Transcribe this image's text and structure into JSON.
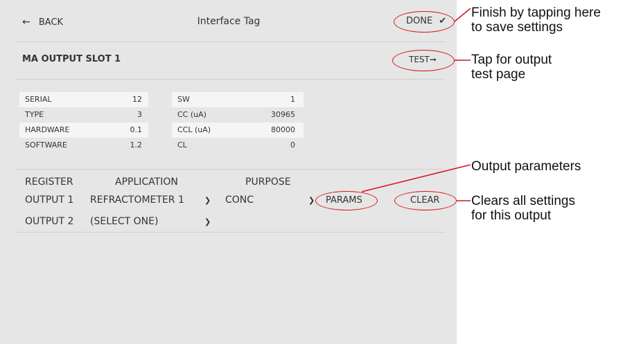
{
  "header": {
    "back_label": "BACK",
    "title": "Interface Tag",
    "done_label": "DONE"
  },
  "slot": {
    "title": "MA OUTPUT SLOT 1",
    "test_label": "TEST"
  },
  "info_left": [
    {
      "label": "SERIAL",
      "value": "12"
    },
    {
      "label": "TYPE",
      "value": "3"
    },
    {
      "label": "HARDWARE",
      "value": "0.1"
    },
    {
      "label": "SOFTWARE",
      "value": "1.2"
    }
  ],
  "info_right": [
    {
      "label": "SW",
      "value": "1"
    },
    {
      "label": "CC (uA)",
      "value": "30965"
    },
    {
      "label": "CCL (uA)",
      "value": "80000"
    },
    {
      "label": "CL",
      "value": "0"
    }
  ],
  "outputs": {
    "headers": {
      "register": "REGISTER",
      "application": "APPLICATION",
      "purpose": "PURPOSE"
    },
    "rows": [
      {
        "register": "OUTPUT 1",
        "application": "REFRACTOMETER 1",
        "purpose": "CONC"
      },
      {
        "register": "OUTPUT 2",
        "application": "(SELECT ONE)",
        "purpose": ""
      }
    ],
    "params_label": "PARAMS",
    "clear_label": "CLEAR"
  },
  "annotations": {
    "done": [
      "Finish by tapping here",
      "to save settings"
    ],
    "test": [
      "Tap for output",
      "test page"
    ],
    "params": [
      "Output parameters"
    ],
    "clear": [
      "Clears all settings",
      "for this output"
    ]
  },
  "icons": {
    "back": "arrow-left-icon",
    "done": "checkmark-icon",
    "test": "arrow-right-icon",
    "dropdown": "chevron-down-icon"
  },
  "colors": {
    "screen_bg": "#e6e6e6",
    "highlight": "#d0161b"
  }
}
